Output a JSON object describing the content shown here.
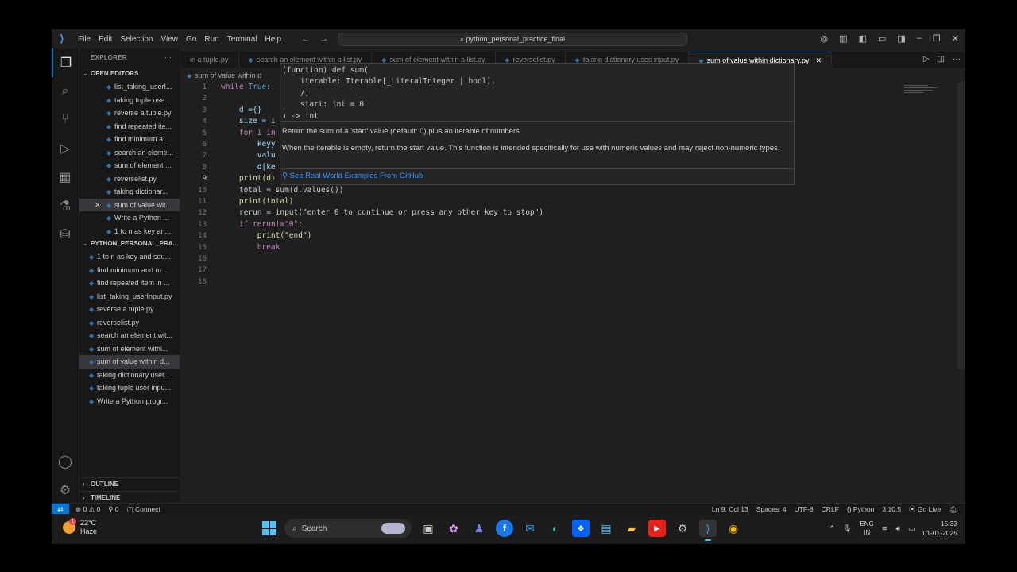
{
  "titlebar": {
    "menu": [
      "File",
      "Edit",
      "Selection",
      "View",
      "Go",
      "Run",
      "Terminal",
      "Help"
    ],
    "search": "python_personal_practice_final"
  },
  "sidebar": {
    "header": "EXPLORER",
    "open_editors_title": "OPEN EDITORS",
    "open_editors": [
      "list_taking_userI...",
      "taking tuple use...",
      "reverse a tuple.py",
      "find repeated ite...",
      "find minimum a...",
      "search an eleme...",
      "sum of element ...",
      "reverselist.py",
      "taking dictionar...",
      "sum of value wit...",
      "Write a Python ...",
      "1 to n as key an..."
    ],
    "project_title": "PYTHON_PERSONAL_PRA...",
    "project_files": [
      "1 to n as key and squ...",
      "find minimum and m...",
      "find repeated item in ...",
      "list_taking_userInput.py",
      "reverse a tuple.py",
      "reverselist.py",
      "search an element wit...",
      "sum of element withi...",
      "sum of value within d...",
      "taking dictionary user...",
      "taking tuple user inpu...",
      "Write a Python progr..."
    ],
    "outline": "OUTLINE",
    "timeline": "TIMELINE"
  },
  "tabs": [
    "in a tuple.py",
    "search an element within a list.py",
    "sum of element within a list.py",
    "reverselist.py",
    "taking dictionary uses input.py",
    "sum of value within dictionary.py"
  ],
  "breadcrumb": "sum of value within d",
  "code_lines": [
    {
      "n": "1",
      "code": "while True:"
    },
    {
      "n": "2",
      "code": ""
    },
    {
      "n": "3",
      "code": "    d ={}"
    },
    {
      "n": "4",
      "code": "    size = i"
    },
    {
      "n": "5",
      "code": "    for i in"
    },
    {
      "n": "6",
      "code": "        keyy"
    },
    {
      "n": "7",
      "code": "        valu"
    },
    {
      "n": "8",
      "code": "        d[ke"
    },
    {
      "n": "9",
      "code": "    print(d)"
    },
    {
      "n": "10",
      "code": "    total = sum(d.values())"
    },
    {
      "n": "11",
      "code": "    print(total)"
    },
    {
      "n": "12",
      "code": "    rerun = input(\"enter 0 to continue or press any other key to stop\")"
    },
    {
      "n": "13",
      "code": "    if rerun!=\"0\":"
    },
    {
      "n": "14",
      "code": "        print(\"end\")"
    },
    {
      "n": "15",
      "code": "        break"
    },
    {
      "n": "16",
      "code": ""
    },
    {
      "n": "17",
      "code": ""
    },
    {
      "n": "18",
      "code": ""
    }
  ],
  "hover": {
    "signature": "(function) def sum(\n    iterable: Iterable[_LiteralInteger | bool],\n    /,\n    start: int = 0\n) -> int",
    "doc1": "Return the sum of a 'start' value (default: 0) plus an iterable of numbers",
    "doc2": "When the iterable is empty, return the start value. This function is intended specifically for use with numeric values and may reject non-numeric types.",
    "github": "See Real World Examples From GitHub"
  },
  "statusbar": {
    "problems": "⊗ 0 ⚠ 0",
    "ports": "⚲ 0",
    "connect": "Connect",
    "position": "Ln 9, Col 13",
    "spaces": "Spaces: 4",
    "encoding": "UTF-8",
    "eol": "CRLF",
    "language": "{} Python",
    "version": "3.10.5",
    "golive": "Go Live"
  },
  "taskbar": {
    "temp": "22°C",
    "weather": "Haze",
    "weather_badge": "1",
    "search": "Search",
    "lang1": "ENG",
    "lang2": "IN",
    "time": "15:33",
    "date": "01-01-2025"
  },
  "colors": {
    "accent": "#0078d4",
    "editor_bg": "#1f1f1f",
    "sidebar_bg": "#181818"
  }
}
